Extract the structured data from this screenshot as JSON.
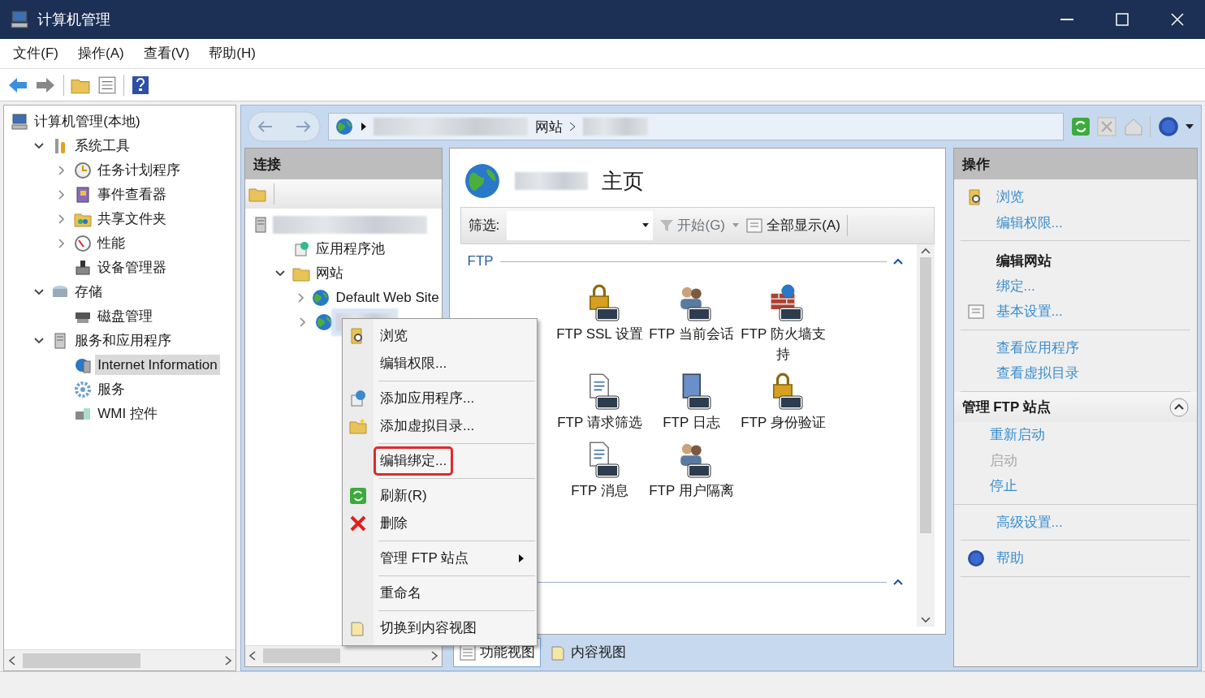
{
  "window": {
    "title": "计算机管理"
  },
  "menu_bar": [
    {
      "label": "文件(F)"
    },
    {
      "label": "操作(A)"
    },
    {
      "label": "查看(V)"
    },
    {
      "label": "帮助(H)"
    }
  ],
  "tree": [
    {
      "label": "计算机管理(本地)",
      "selected": false,
      "children": [
        {
          "label": "系统工具",
          "expanded": true,
          "selected": false,
          "children": [
            {
              "label": "任务计划程序",
              "expanded": false,
              "selected": false
            },
            {
              "label": "事件查看器",
              "expanded": false,
              "selected": false
            },
            {
              "label": "共享文件夹",
              "expanded": false,
              "selected": false
            },
            {
              "label": "性能",
              "expanded": false,
              "selected": false
            },
            {
              "label": "设备管理器",
              "selected": false
            }
          ]
        },
        {
          "label": "存储",
          "expanded": true,
          "selected": false,
          "children": [
            {
              "label": "磁盘管理",
              "selected": false
            }
          ]
        },
        {
          "label": "服务和应用程序",
          "expanded": true,
          "selected": false,
          "children": [
            {
              "label": "Internet Information",
              "selected": true
            },
            {
              "label": "服务",
              "selected": false
            },
            {
              "label": "WMI 控件",
              "selected": false
            }
          ]
        }
      ]
    }
  ],
  "breadcrumb": [
    {
      "label": "网站"
    }
  ],
  "connections": {
    "title": "连接",
    "tree": [
      {
        "blurred": true,
        "selected": false,
        "children": [
          {
            "label": "应用程序池",
            "selected": false
          },
          {
            "label": "网站",
            "expanded": true,
            "selected": false,
            "children": [
              {
                "label": "Default Web Site",
                "expanded": false,
                "selected": false
              },
              {
                "blurred": true,
                "expanded": false,
                "selected": true
              }
            ]
          }
        ]
      }
    ]
  },
  "home": {
    "title": "主页",
    "filter_label": "筛选:",
    "start": "开始(G)",
    "show_all": "全部显示(A)",
    "group": "FTP",
    "features": [
      {
        "label": "FTP SSL 设置"
      },
      {
        "label": "FTP 当前会话"
      },
      {
        "label": "FTP 防火墙支持"
      },
      {
        "label": "FTP 请求筛选"
      },
      {
        "label": "FTP 日志"
      },
      {
        "label": "FTP 身份验证"
      },
      {
        "label": "FTP 消息"
      },
      {
        "label": "FTP 用户隔离"
      }
    ]
  },
  "view_tabs": [
    {
      "label": "功能视图",
      "selected": true
    },
    {
      "label": "内容视图",
      "selected": false
    }
  ],
  "context_menu": [
    {
      "kind": "item",
      "label": "浏览",
      "highlighted": false
    },
    {
      "kind": "item",
      "label": "编辑权限...",
      "highlighted": false
    },
    {
      "kind": "separator"
    },
    {
      "kind": "item",
      "label": "添加应用程序...",
      "highlighted": false
    },
    {
      "kind": "item",
      "label": "添加虚拟目录...",
      "highlighted": false
    },
    {
      "kind": "separator"
    },
    {
      "kind": "item",
      "label": "编辑绑定...",
      "highlighted": true
    },
    {
      "kind": "separator"
    },
    {
      "kind": "item",
      "label": "刷新(R)",
      "highlighted": false
    },
    {
      "kind": "item",
      "label": "删除",
      "highlighted": false
    },
    {
      "kind": "separator"
    },
    {
      "kind": "submenu",
      "label": "管理 FTP 站点",
      "highlighted": false
    },
    {
      "kind": "separator"
    },
    {
      "kind": "item",
      "label": "重命名",
      "highlighted": false
    },
    {
      "kind": "separator"
    },
    {
      "kind": "item",
      "label": "切换到内容视图",
      "highlighted": false
    }
  ],
  "actions": {
    "title": "操作",
    "sections": [
      {
        "kind": "plain",
        "items": [
          {
            "label": "浏览",
            "disabled": false
          },
          {
            "label": "编辑权限...",
            "disabled": false
          }
        ]
      },
      {
        "kind": "plain",
        "heading": "编辑网站",
        "items": [
          {
            "label": "绑定...",
            "disabled": false
          },
          {
            "label": "基本设置...",
            "disabled": false
          }
        ]
      },
      {
        "kind": "plain",
        "items": [
          {
            "label": "查看应用程序",
            "disabled": false
          },
          {
            "label": "查看虚拟目录",
            "disabled": false
          }
        ]
      },
      {
        "kind": "collapsible",
        "heading": "管理 FTP 站点",
        "expanded": true,
        "items": [
          {
            "label": "重新启动",
            "disabled": false
          },
          {
            "label": "启动",
            "disabled": true
          },
          {
            "label": "停止",
            "disabled": false
          }
        ]
      },
      {
        "kind": "plain",
        "items": [
          {
            "label": "高级设置...",
            "disabled": false
          }
        ]
      },
      {
        "kind": "plain",
        "items": [
          {
            "label": "帮助",
            "disabled": false
          }
        ]
      }
    ]
  }
}
